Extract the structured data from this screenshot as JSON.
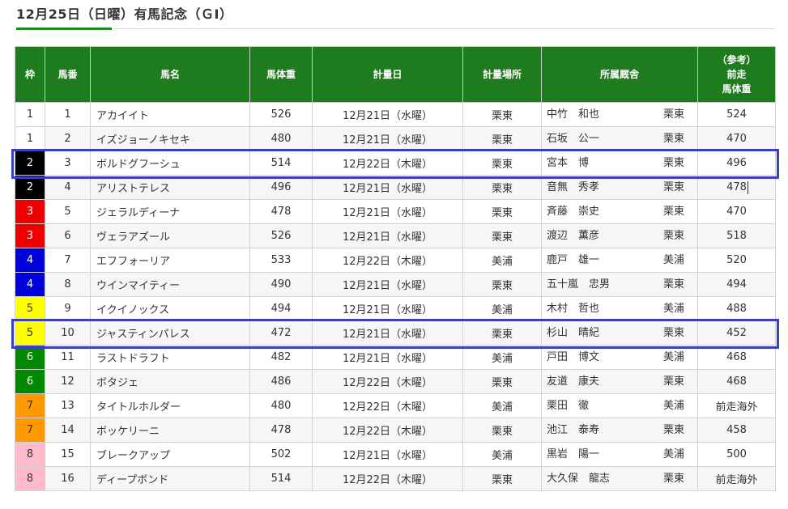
{
  "page": {
    "title": "12月25日（日曜）有馬記念（ＧⅠ）"
  },
  "table": {
    "headers": {
      "waku": "枠",
      "umaban": "馬番",
      "name": "馬名",
      "weight": "馬体重",
      "date": "計量日",
      "place": "計量場所",
      "stable": "所属厩舎",
      "prev_line1": "（参考）",
      "prev_line2": "前走",
      "prev_line3": "馬体重"
    },
    "rows": [
      {
        "waku": "1",
        "umaban": "1",
        "name": "アカイイト",
        "weight": "526",
        "date": "12月21日（水曜）",
        "place": "栗東",
        "trainer": "中竹　和也",
        "region": "栗東",
        "prev": "524"
      },
      {
        "waku": "1",
        "umaban": "2",
        "name": "イズジョーノキセキ",
        "weight": "480",
        "date": "12月21日（水曜）",
        "place": "栗東",
        "trainer": "石坂　公一",
        "region": "栗東",
        "prev": "470"
      },
      {
        "waku": "2",
        "umaban": "3",
        "name": "ボルドグフーシュ",
        "weight": "514",
        "date": "12月22日（木曜）",
        "place": "栗東",
        "trainer": "宮本　博",
        "region": "栗東",
        "prev": "496"
      },
      {
        "waku": "2",
        "umaban": "4",
        "name": "アリストテレス",
        "weight": "496",
        "date": "12月21日（水曜）",
        "place": "栗東",
        "trainer": "音無　秀孝",
        "region": "栗東",
        "prev": "478"
      },
      {
        "waku": "3",
        "umaban": "5",
        "name": "ジェラルディーナ",
        "weight": "478",
        "date": "12月21日（水曜）",
        "place": "栗東",
        "trainer": "斉藤　崇史",
        "region": "栗東",
        "prev": "470"
      },
      {
        "waku": "3",
        "umaban": "6",
        "name": "ヴェラアズール",
        "weight": "526",
        "date": "12月21日（水曜）",
        "place": "栗東",
        "trainer": "渡辺　薫彦",
        "region": "栗東",
        "prev": "518"
      },
      {
        "waku": "4",
        "umaban": "7",
        "name": "エフフォーリア",
        "weight": "533",
        "date": "12月22日（木曜）",
        "place": "美浦",
        "trainer": "鹿戸　雄一",
        "region": "美浦",
        "prev": "520"
      },
      {
        "waku": "4",
        "umaban": "8",
        "name": "ウインマイティー",
        "weight": "490",
        "date": "12月21日（水曜）",
        "place": "栗東",
        "trainer": "五十嵐　忠男",
        "region": "栗東",
        "prev": "494"
      },
      {
        "waku": "5",
        "umaban": "9",
        "name": "イクイノックス",
        "weight": "494",
        "date": "12月21日（水曜）",
        "place": "美浦",
        "trainer": "木村　哲也",
        "region": "美浦",
        "prev": "488"
      },
      {
        "waku": "5",
        "umaban": "10",
        "name": "ジャスティンパレス",
        "weight": "472",
        "date": "12月21日（水曜）",
        "place": "栗東",
        "trainer": "杉山　晴紀",
        "region": "栗東",
        "prev": "452"
      },
      {
        "waku": "6",
        "umaban": "11",
        "name": "ラストドラフト",
        "weight": "482",
        "date": "12月21日（水曜）",
        "place": "美浦",
        "trainer": "戸田　博文",
        "region": "美浦",
        "prev": "468"
      },
      {
        "waku": "6",
        "umaban": "12",
        "name": "ボタジェ",
        "weight": "486",
        "date": "12月22日（木曜）",
        "place": "栗東",
        "trainer": "友道　康夫",
        "region": "栗東",
        "prev": "468"
      },
      {
        "waku": "7",
        "umaban": "13",
        "name": "タイトルホルダー",
        "weight": "480",
        "date": "12月22日（木曜）",
        "place": "美浦",
        "trainer": "栗田　徹",
        "region": "美浦",
        "prev": "前走海外"
      },
      {
        "waku": "7",
        "umaban": "14",
        "name": "ボッケリーニ",
        "weight": "478",
        "date": "12月22日（木曜）",
        "place": "栗東",
        "trainer": "池江　泰寿",
        "region": "栗東",
        "prev": "458"
      },
      {
        "waku": "8",
        "umaban": "15",
        "name": "ブレークアップ",
        "weight": "502",
        "date": "12月21日（水曜）",
        "place": "美浦",
        "trainer": "黒岩　陽一",
        "region": "美浦",
        "prev": "500"
      },
      {
        "waku": "8",
        "umaban": "16",
        "name": "ディープボンド",
        "weight": "514",
        "date": "12月22日（木曜）",
        "place": "栗東",
        "trainer": "大久保　龍志",
        "region": "栗東",
        "prev": "前走海外"
      }
    ]
  },
  "colors": {
    "header_green": "#1e7b1e",
    "title_accent": "#1f8a1f",
    "highlight_border": "#3a3ec0",
    "waku": {
      "1": "#ffffff",
      "2": "#000000",
      "3": "#ee0000",
      "4": "#0000dd",
      "5": "#ffff00",
      "6": "#008800",
      "7": "#ff9900",
      "8": "#ffbbcc"
    }
  },
  "highlighted_umaban": [
    "3",
    "10"
  ]
}
